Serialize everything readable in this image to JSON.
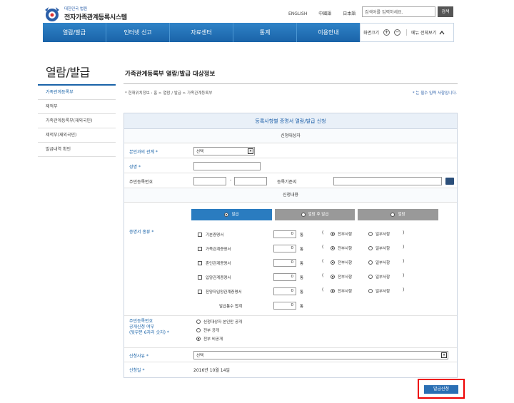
{
  "header": {
    "logo_small": "대한민국 법원",
    "logo_title": "전자가족관계등록시스템",
    "languages": [
      "ENGLISH",
      "中國語",
      "日本語"
    ],
    "search_placeholder": "검색어를 입력하세요.",
    "search_button": "검색"
  },
  "nav": {
    "items": [
      "열람/발급",
      "인터넷 신고",
      "자료센터",
      "통계",
      "이용안내"
    ],
    "zoom_label": "화면크기",
    "zoom_in": "+",
    "zoom_out": "−",
    "menu_all": "메뉴 전체보기"
  },
  "sidebar": {
    "title": "열람/발급",
    "items": [
      {
        "label": "가족관계등록부",
        "active": true
      },
      {
        "label": "제적부",
        "active": false
      },
      {
        "label": "가족관계등록부(재외국민)",
        "active": false
      },
      {
        "label": "제적부(재외국민)",
        "active": false
      },
      {
        "label": "발급내역 확인",
        "active": false
      }
    ]
  },
  "content": {
    "title": "가족관계등록부 열람/발급 대상정보",
    "breadcrumb": "* 현재위치정보 : 홈 > 열람 / 발급 > 가족관계등록부",
    "required_note": "* 는 필수 입력 사항입니다."
  },
  "form": {
    "heading": "등록사항별 증명서 열람/발급 신청",
    "target_section": "신청대상자",
    "relation_label": "본인과의 관계 *",
    "relation_value": "선택",
    "name_label": "성명 *",
    "name_value": "",
    "rrn_label": "주민등록번호",
    "rrn_separator": "-",
    "reg_label": "등록기준지",
    "content_section": "신청내용",
    "tabs": [
      {
        "label": "발급",
        "active": true
      },
      {
        "label": "열람 후 발급",
        "active": false
      },
      {
        "label": "열람",
        "active": false
      }
    ],
    "cert_label": "증명서 종류 *",
    "certs": [
      {
        "name": "기본증명서",
        "count": "0",
        "unit": "통"
      },
      {
        "name": "가족관계증명서",
        "count": "0",
        "unit": "통"
      },
      {
        "name": "혼인관계증명서",
        "count": "0",
        "unit": "통"
      },
      {
        "name": "입양관계증명서",
        "count": "0",
        "unit": "통"
      },
      {
        "name": "친양자입양관계증명서",
        "count": "0",
        "unit": "통"
      }
    ],
    "scope_all": "전부사항",
    "scope_part": "일부사항",
    "total_label": "발급통수 합계",
    "total_count": "0",
    "total_unit": "통",
    "rrn_disclose_label": [
      "주민등록번호",
      "공개신청 여부",
      "(뒷부분 6자리 숫자) *"
    ],
    "rrn_options": [
      {
        "label": "신청대상자 본인만 공개",
        "checked": false
      },
      {
        "label": "전부 공개",
        "checked": false
      },
      {
        "label": "전부 비공개",
        "checked": true
      }
    ],
    "reason_label": "신청사유 *",
    "reason_value": "선택",
    "date_label": "신청일 *",
    "date_value": "2016년 10월 14일",
    "submit": "발급신청"
  },
  "colors": {
    "nav_blue": "#1a63a8",
    "accent_blue": "#2a7cc0",
    "highlight_red": "#e00000"
  }
}
